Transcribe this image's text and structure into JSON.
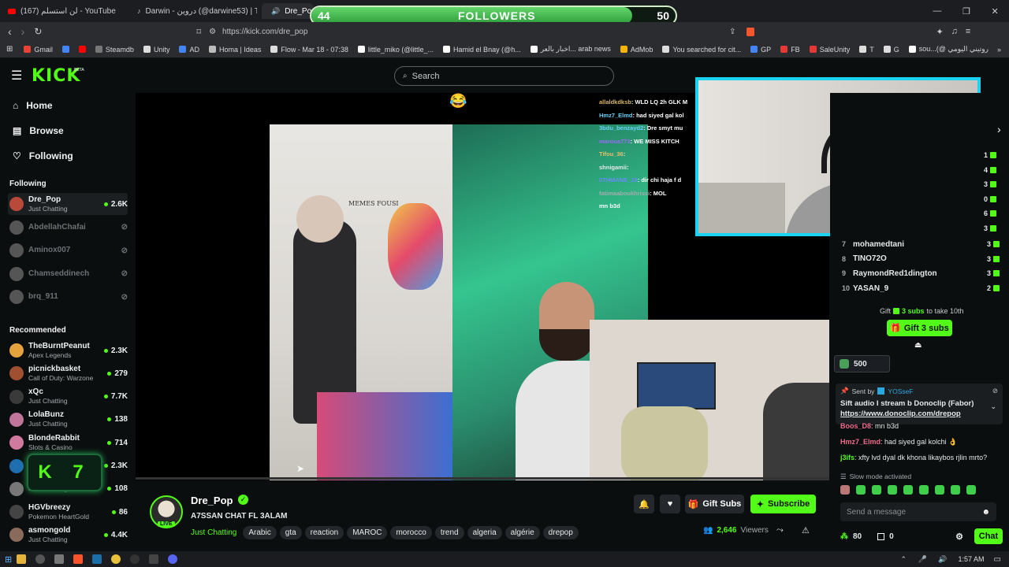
{
  "browser": {
    "tabs": [
      {
        "title": "(167) لن استسلم - YouTube",
        "icon_color": "#ff0000"
      },
      {
        "title": "Darwin - دروين (@darwine53) | TikTok",
        "icon_color": "#ffffff"
      },
      {
        "title": "Dre_Pop",
        "icon_color": "#53fc18"
      }
    ],
    "url": "https://kick.com/dre_pop",
    "bookmarks": [
      "Gmail",
      "",
      "",
      "Steamdb",
      "Unity",
      "AD",
      "Homa | Ideas",
      "Flow - Mar 18 - 07:38",
      "little_miko (@little_...",
      "Hamid el Bnay (@h...",
      "اخبار بالعر... arab news",
      "AdMob",
      "You searched for cit...",
      "GP",
      "FB",
      "SaleUnity",
      "T",
      "G",
      "sou...(@ روتيني اليومي"
    ]
  },
  "overlay": {
    "followers_label": "FOLLOWERS",
    "current": "44",
    "goal": "50",
    "progress": 0.88
  },
  "header": {
    "logo": "KICK",
    "beta": "BETA",
    "search_placeholder": "Search"
  },
  "sidebar": {
    "nav": [
      {
        "label": "Home",
        "icon": "home-icon"
      },
      {
        "label": "Browse",
        "icon": "browse-icon"
      },
      {
        "label": "Following",
        "icon": "heart-icon"
      }
    ],
    "following_title": "Following",
    "following": [
      {
        "name": "Dre_Pop",
        "game": "Just Chatting",
        "viewers": "2.6K",
        "live": true
      },
      {
        "name": "AbdellahChafai",
        "live": false
      },
      {
        "name": "Aminox007",
        "live": false
      },
      {
        "name": "Chamseddinech",
        "live": false
      },
      {
        "name": "brq_911",
        "live": false
      }
    ],
    "recommended_title": "Recommended",
    "recommended": [
      {
        "name": "TheBurntPeanut",
        "game": "Apex Legends",
        "viewers": "2.3K"
      },
      {
        "name": "picnickbasket",
        "game": "Call of Duty: Warzone",
        "viewers": "279"
      },
      {
        "name": "xQc",
        "game": "Just Chatting",
        "viewers": "7.7K"
      },
      {
        "name": "LolaBunz",
        "game": "Just Chatting",
        "viewers": "138"
      },
      {
        "name": "BlondeRabbit",
        "game": "Slots & Casino",
        "viewers": "714"
      },
      {
        "name": "",
        "game": "",
        "viewers": "2.3K"
      },
      {
        "name": "",
        "game": "Just Chatting",
        "viewers": "108"
      },
      {
        "name": "HGVbreezy",
        "game": "Pokemon HeartGold",
        "viewers": "86"
      },
      {
        "name": "asmongold",
        "game": "Just Chatting",
        "viewers": "4.4K"
      }
    ],
    "badge_text": "K 7"
  },
  "video": {
    "overlay_chat": [
      {
        "user": "allaldkdksb",
        "text": ": WLD LQ 2h GLK M",
        "color": "#d7b46a"
      },
      {
        "user": "Hmz7_Elmd",
        "text": ": had siyed gal kol",
        "color": "#6ad0f5"
      },
      {
        "user": "3bdu_benzayd2",
        "text": ": Dre smyt mu",
        "color": "#6ad0f5"
      },
      {
        "user": "maroua773",
        "text": ": WE MISS KITCH",
        "color": "#9a6af5"
      },
      {
        "user": "Tifou_36",
        "text": ":",
        "color": "#e6c06a"
      },
      {
        "user": "shnigamii",
        "text": ":",
        "color": "#e6e8ea"
      },
      {
        "user": "0THMANE_18",
        "text": ": dir chi haja f d",
        "color": "#6a8cf5"
      },
      {
        "user": "fatimaaboukhrissi",
        "text": ": MOL",
        "color": "#a6abaf"
      },
      {
        "user": "",
        "text": "mn b3d",
        "color": "#e6e8ea"
      }
    ],
    "poster_text": "MEMES FOUSI"
  },
  "chat": {
    "leaderboard": [
      {
        "rank": "7",
        "name": "mohamedtani",
        "value": "3"
      },
      {
        "rank": "8",
        "name": "TINO72O",
        "value": "3"
      },
      {
        "rank": "9",
        "name": "RaymondRed1dington",
        "value": "3"
      },
      {
        "rank": "10",
        "name": "YASAN_9",
        "value": "2"
      }
    ],
    "side_values": [
      "1",
      "4",
      "3",
      "0",
      "6",
      "3"
    ],
    "gift_prompt_pre": "Gift",
    "gift_prompt_subs": "3 subs",
    "gift_prompt_post": "to take 10th",
    "gift_button": "Gift 3 subs",
    "kicks_value": "500",
    "pinned": {
      "sent_by_label": "Sent by",
      "sender": "YOSseF",
      "text": "Sift audio I stream b Donoclip (Fabor)",
      "link": "https://www.donoclip.com/drepop"
    },
    "messages": [
      {
        "user": "Boos_D8",
        "text": ": mn b3d",
        "color": "#f06a8c"
      },
      {
        "user": "Hmz7_Elmd",
        "text": ": had siyed gal kolchi 👌",
        "color": "#f06a8c"
      },
      {
        "user": "j3ifs",
        "text": ": xfty lvd dyal dk khona likaybos rjlin mrto?",
        "color": "#53fc18"
      }
    ],
    "slow_mode": "Slow mode activated",
    "input_placeholder": "Send a message",
    "points": "80",
    "kicks": "0",
    "chat_button": "Chat"
  },
  "stream": {
    "username": "Dre_Pop",
    "title": "A7SSAN CHAT FL 3ALAM",
    "category": "Just Chatting",
    "tags": [
      "Arabic",
      "gta",
      "reaction",
      "MAROC",
      "morocco",
      "trend",
      "algeria",
      "algérie",
      "drepop"
    ],
    "live_label": "LIVE",
    "viewers": "2,646",
    "viewers_label": "Viewers",
    "gift_subs": "Gift Subs",
    "subscribe": "Subscribe"
  },
  "taskbar": {
    "time": "1:57 AM"
  },
  "colors": {
    "accent": "#53fc18",
    "bg": "#0b0e0f",
    "cam_border": "#19d3f0"
  }
}
